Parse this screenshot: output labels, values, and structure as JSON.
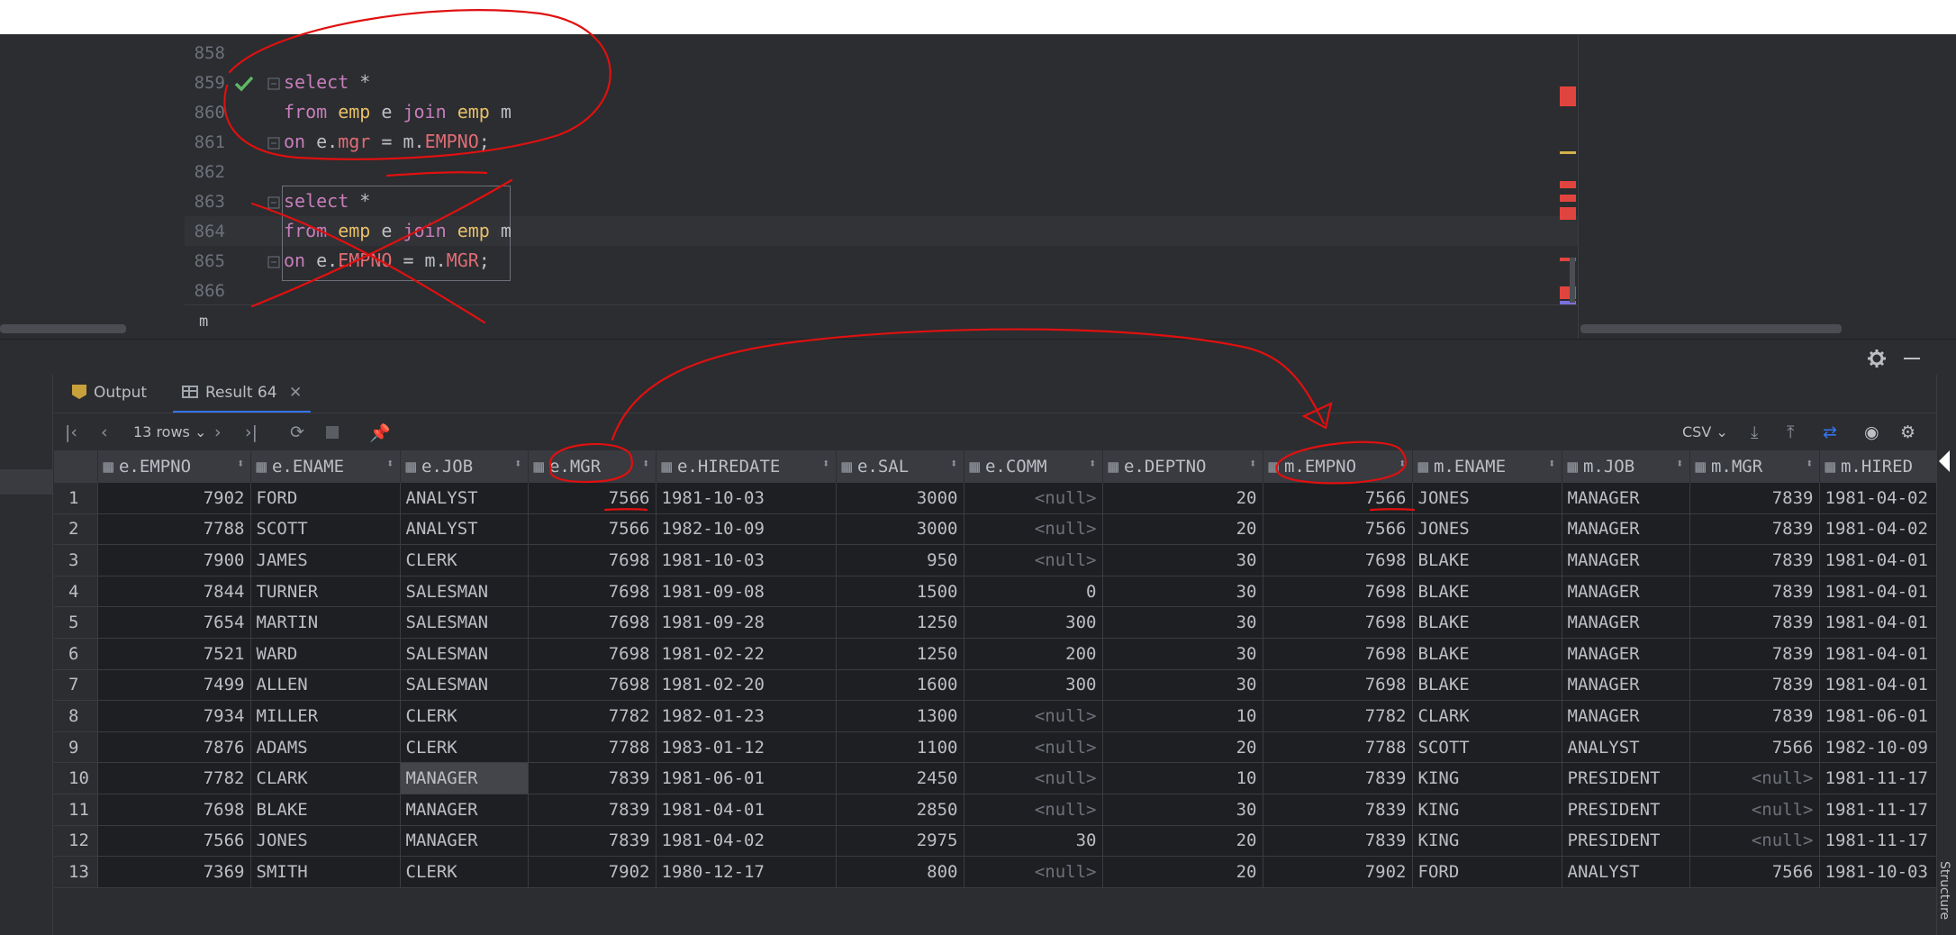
{
  "editor": {
    "line_numbers": [
      "858",
      "859",
      "860",
      "861",
      "862",
      "863",
      "864",
      "865",
      "866"
    ],
    "query1": {
      "l1": {
        "kw": "select",
        "rest": " *"
      },
      "l2": {
        "kw1": "from",
        "t1": "emp",
        "a1": " e ",
        "kw2": "join",
        "t2": "emp",
        "a2": " m"
      },
      "l3": {
        "kw": "on",
        "p1": " e.",
        "f1": "mgr",
        "p2": " = m.",
        "f2": "EMPNO",
        "p3": ";"
      }
    },
    "query2": {
      "l1": {
        "kw": "select",
        "rest": " *"
      },
      "l2": {
        "kw1": "from",
        "t1": "emp",
        "a1": " e ",
        "kw2": "join",
        "t2": "emp",
        "a2": " m"
      },
      "l3": {
        "kw": "on",
        "p1": " e.",
        "f1": "EMPNO",
        "p2": " = m.",
        "f2": "MGR",
        "p3": ";"
      }
    },
    "breadcrumb": "m",
    "colors": {
      "keyword": "#c77dbb",
      "table": "#e8bf6a",
      "field": "#e06c75",
      "check": "#5fb865",
      "annotation": "#e01010"
    }
  },
  "panel": {
    "tabs": [
      {
        "label": "Output",
        "icon": "output-icon"
      },
      {
        "label": "Result 64",
        "icon": "table-icon"
      }
    ],
    "rows_selector": "13 rows",
    "export_format": "CSV"
  },
  "grid": {
    "columns": [
      "e.EMPNO",
      "e.ENAME",
      "e.JOB",
      "e.MGR",
      "e.HIREDATE",
      "e.SAL",
      "e.COMM",
      "e.DEPTNO",
      "m.EMPNO",
      "m.ENAME",
      "m.JOB",
      "m.MGR",
      "m.HIRED"
    ],
    "rows": [
      [
        "1",
        "7902",
        "FORD",
        "ANALYST",
        "7566",
        "1981-10-03",
        "3000",
        "<null>",
        "20",
        "7566",
        "JONES",
        "MANAGER",
        "7839",
        "1981-04-02"
      ],
      [
        "2",
        "7788",
        "SCOTT",
        "ANALYST",
        "7566",
        "1982-10-09",
        "3000",
        "<null>",
        "20",
        "7566",
        "JONES",
        "MANAGER",
        "7839",
        "1981-04-02"
      ],
      [
        "3",
        "7900",
        "JAMES",
        "CLERK",
        "7698",
        "1981-10-03",
        "950",
        "<null>",
        "30",
        "7698",
        "BLAKE",
        "MANAGER",
        "7839",
        "1981-04-01"
      ],
      [
        "4",
        "7844",
        "TURNER",
        "SALESMAN",
        "7698",
        "1981-09-08",
        "1500",
        "0",
        "30",
        "7698",
        "BLAKE",
        "MANAGER",
        "7839",
        "1981-04-01"
      ],
      [
        "5",
        "7654",
        "MARTIN",
        "SALESMAN",
        "7698",
        "1981-09-28",
        "1250",
        "300",
        "30",
        "7698",
        "BLAKE",
        "MANAGER",
        "7839",
        "1981-04-01"
      ],
      [
        "6",
        "7521",
        "WARD",
        "SALESMAN",
        "7698",
        "1981-02-22",
        "1250",
        "200",
        "30",
        "7698",
        "BLAKE",
        "MANAGER",
        "7839",
        "1981-04-01"
      ],
      [
        "7",
        "7499",
        "ALLEN",
        "SALESMAN",
        "7698",
        "1981-02-20",
        "1600",
        "300",
        "30",
        "7698",
        "BLAKE",
        "MANAGER",
        "7839",
        "1981-04-01"
      ],
      [
        "8",
        "7934",
        "MILLER",
        "CLERK",
        "7782",
        "1982-01-23",
        "1300",
        "<null>",
        "10",
        "7782",
        "CLARK",
        "MANAGER",
        "7839",
        "1981-06-01"
      ],
      [
        "9",
        "7876",
        "ADAMS",
        "CLERK",
        "7788",
        "1983-01-12",
        "1100",
        "<null>",
        "20",
        "7788",
        "SCOTT",
        "ANALYST",
        "7566",
        "1982-10-09"
      ],
      [
        "10",
        "7782",
        "CLARK",
        "MANAGER",
        "7839",
        "1981-06-01",
        "2450",
        "<null>",
        "10",
        "7839",
        "KING",
        "PRESIDENT",
        "<null>",
        "1981-11-17"
      ],
      [
        "11",
        "7698",
        "BLAKE",
        "MANAGER",
        "7839",
        "1981-04-01",
        "2850",
        "<null>",
        "30",
        "7839",
        "KING",
        "PRESIDENT",
        "<null>",
        "1981-11-17"
      ],
      [
        "12",
        "7566",
        "JONES",
        "MANAGER",
        "7839",
        "1981-04-02",
        "2975",
        "30",
        "20",
        "7839",
        "KING",
        "PRESIDENT",
        "<null>",
        "1981-11-17"
      ],
      [
        "13",
        "7369",
        "SMITH",
        "CLERK",
        "7902",
        "1980-12-17",
        "800",
        "<null>",
        "20",
        "7902",
        "FORD",
        "ANALYST",
        "7566",
        "1981-10-03"
      ]
    ]
  },
  "sidebar_right": {
    "label": "Structure"
  }
}
